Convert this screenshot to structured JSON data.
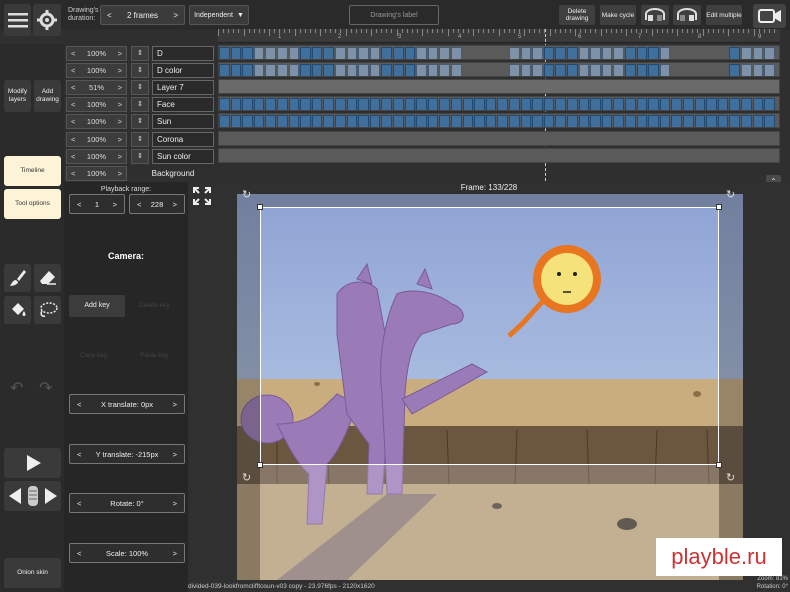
{
  "toolbar": {
    "duration_label": "Drawing's duration:",
    "frames_value": "2 frames",
    "mode_value": "Independent",
    "drawing_label_placeholder": "Drawing's label",
    "delete_drawing": "Delete drawing",
    "make_cycle": "Make cycle",
    "edit_multiple": "Edit multiple"
  },
  "ruler": {
    "numbers": [
      "1",
      "2",
      "3",
      "4",
      "5",
      "6",
      "7",
      "8",
      "9"
    ]
  },
  "layers": [
    {
      "pct": "100%",
      "name": "D"
    },
    {
      "pct": "100%",
      "name": "D color"
    },
    {
      "pct": "51%",
      "name": "Layer 7"
    },
    {
      "pct": "100%",
      "name": "Face"
    },
    {
      "pct": "100%",
      "name": "Sun"
    },
    {
      "pct": "100%",
      "name": "Corona"
    },
    {
      "pct": "100%",
      "name": "Sun color"
    },
    {
      "pct": "100%",
      "name": "Background"
    }
  ],
  "sidebar": {
    "modify_layers": "Modify layers",
    "add_drawing": "Add drawing",
    "timeline": "Timeline",
    "tool_options": "Tool options",
    "onion_skin": "Onion skin"
  },
  "panel": {
    "playback_range_label": "Playback range:",
    "range_start": "1",
    "range_end": "228",
    "camera_label": "Camera:",
    "add_key": "Add key",
    "delete_key": "Delete key",
    "copy_key": "Copy key",
    "paste_key": "Paste key",
    "x_translate": "X translate: 0px",
    "y_translate": "Y translate: -215px",
    "rotate": "Rotate:  0°",
    "scale": "Scale:  100%"
  },
  "viewer": {
    "frame_label": "Frame: 133/228",
    "file_info": "divided-039-lookfromclifftosun-v03 copy - 23.976fps - 2120x1620",
    "zoom": "Zoom: 81%",
    "rotation": "Rotation: 0°",
    "watermark": "playble.ru"
  },
  "icons": {
    "menu": "hamburger-icon",
    "settings": "gear-icon",
    "camera": "video-camera-icon"
  }
}
